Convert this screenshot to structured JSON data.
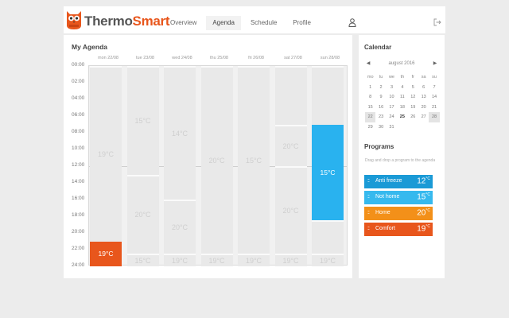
{
  "app": {
    "brand_part1": "Thermo",
    "brand_part2": "Smart"
  },
  "nav": {
    "tabs": [
      "Overview",
      "Agenda",
      "Schedule",
      "Profile"
    ],
    "active": "Agenda"
  },
  "agenda": {
    "title": "My Agenda",
    "days": [
      "mon 22/08",
      "tue 23/08",
      "wed 24/08",
      "thu 25/08",
      "fri 26/08",
      "sat 27/08",
      "sun 28/08"
    ],
    "hours": [
      "00:00",
      "02:00",
      "04:00",
      "06:00",
      "08:00",
      "10:00",
      "12:00",
      "14:00",
      "16:00",
      "18:00",
      "20:00",
      "22:00",
      "24:00"
    ],
    "blocks": [
      [
        {
          "start": 0,
          "end": 21,
          "label": "19°C"
        },
        {
          "start": 21,
          "end": 24,
          "label": "19°C",
          "active": true,
          "color": "#e8561c"
        }
      ],
      [
        {
          "start": 0,
          "end": 13,
          "label": "15°C"
        },
        {
          "start": 13,
          "end": 22.5,
          "label": "20°C"
        },
        {
          "start": 22.5,
          "end": 24,
          "label": "15°C"
        }
      ],
      [
        {
          "start": 0,
          "end": 16,
          "label": "14°C"
        },
        {
          "start": 16,
          "end": 22.5,
          "label": "20°C"
        },
        {
          "start": 22.5,
          "end": 24,
          "label": "19°C"
        }
      ],
      [
        {
          "start": 0,
          "end": 22.5,
          "label": "20°C"
        },
        {
          "start": 22.5,
          "end": 24,
          "label": "19°C"
        }
      ],
      [
        {
          "start": 0,
          "end": 22.5,
          "label": "15°C"
        },
        {
          "start": 22.5,
          "end": 24,
          "label": "19°C"
        }
      ],
      [
        {
          "start": 0,
          "end": 7,
          "label": ""
        },
        {
          "start": 7,
          "end": 12,
          "label": "20°C"
        },
        {
          "start": 12,
          "end": 22.5,
          "label": "20°C"
        },
        {
          "start": 22.5,
          "end": 24,
          "label": "19°C"
        }
      ],
      [
        {
          "start": 0,
          "end": 7,
          "label": ""
        },
        {
          "start": 7,
          "end": 18.5,
          "label": "15°C",
          "active": true,
          "color": "#29b2ef"
        },
        {
          "start": 18.5,
          "end": 22.5,
          "label": ""
        },
        {
          "start": 22.5,
          "end": 24,
          "label": "19°C"
        }
      ]
    ]
  },
  "calendar": {
    "title": "Calendar",
    "month": "august 2016",
    "prev": "◀",
    "next": "▶",
    "weekdays": [
      "mo",
      "tu",
      "we",
      "th",
      "fr",
      "sa",
      "su"
    ],
    "weeks": [
      [
        {
          "d": "1"
        },
        {
          "d": "2"
        },
        {
          "d": "3"
        },
        {
          "d": "4"
        },
        {
          "d": "5"
        },
        {
          "d": "6"
        },
        {
          "d": "7"
        }
      ],
      [
        {
          "d": "8"
        },
        {
          "d": "9"
        },
        {
          "d": "10"
        },
        {
          "d": "11"
        },
        {
          "d": "12"
        },
        {
          "d": "13"
        },
        {
          "d": "14"
        }
      ],
      [
        {
          "d": "15"
        },
        {
          "d": "16"
        },
        {
          "d": "17"
        },
        {
          "d": "18"
        },
        {
          "d": "19"
        },
        {
          "d": "20"
        },
        {
          "d": "21"
        }
      ],
      [
        {
          "d": "22",
          "week": true
        },
        {
          "d": "23"
        },
        {
          "d": "24"
        },
        {
          "d": "25",
          "today": true
        },
        {
          "d": "26"
        },
        {
          "d": "27"
        },
        {
          "d": "28",
          "week": true
        }
      ],
      [
        {
          "d": "29"
        },
        {
          "d": "30"
        },
        {
          "d": "31"
        },
        {
          "d": "",
          "other": true
        },
        {
          "d": "",
          "other": true
        },
        {
          "d": "",
          "other": true
        },
        {
          "d": "",
          "other": true
        }
      ]
    ]
  },
  "programs": {
    "title": "Programs",
    "hint": "Drag and drop a program to the agenda",
    "items": [
      {
        "name": "Anti freeze",
        "temp": "12",
        "unit": "°C",
        "color": "#1a9ad6"
      },
      {
        "name": "Not home",
        "temp": "15",
        "unit": "°C",
        "color": "#36b9ee"
      },
      {
        "name": "Home",
        "temp": "20",
        "unit": "°C",
        "color": "#f39019"
      },
      {
        "name": "Comfort",
        "temp": "19",
        "unit": "°C",
        "color": "#e8561c"
      }
    ]
  },
  "icons": {
    "logo": "owl-logo-icon",
    "user": "user-icon",
    "logout": "logout-icon",
    "grip": "drag-grip-icon"
  },
  "colors": {
    "brand": "#e8561c",
    "active_blue": "#29b2ef"
  }
}
